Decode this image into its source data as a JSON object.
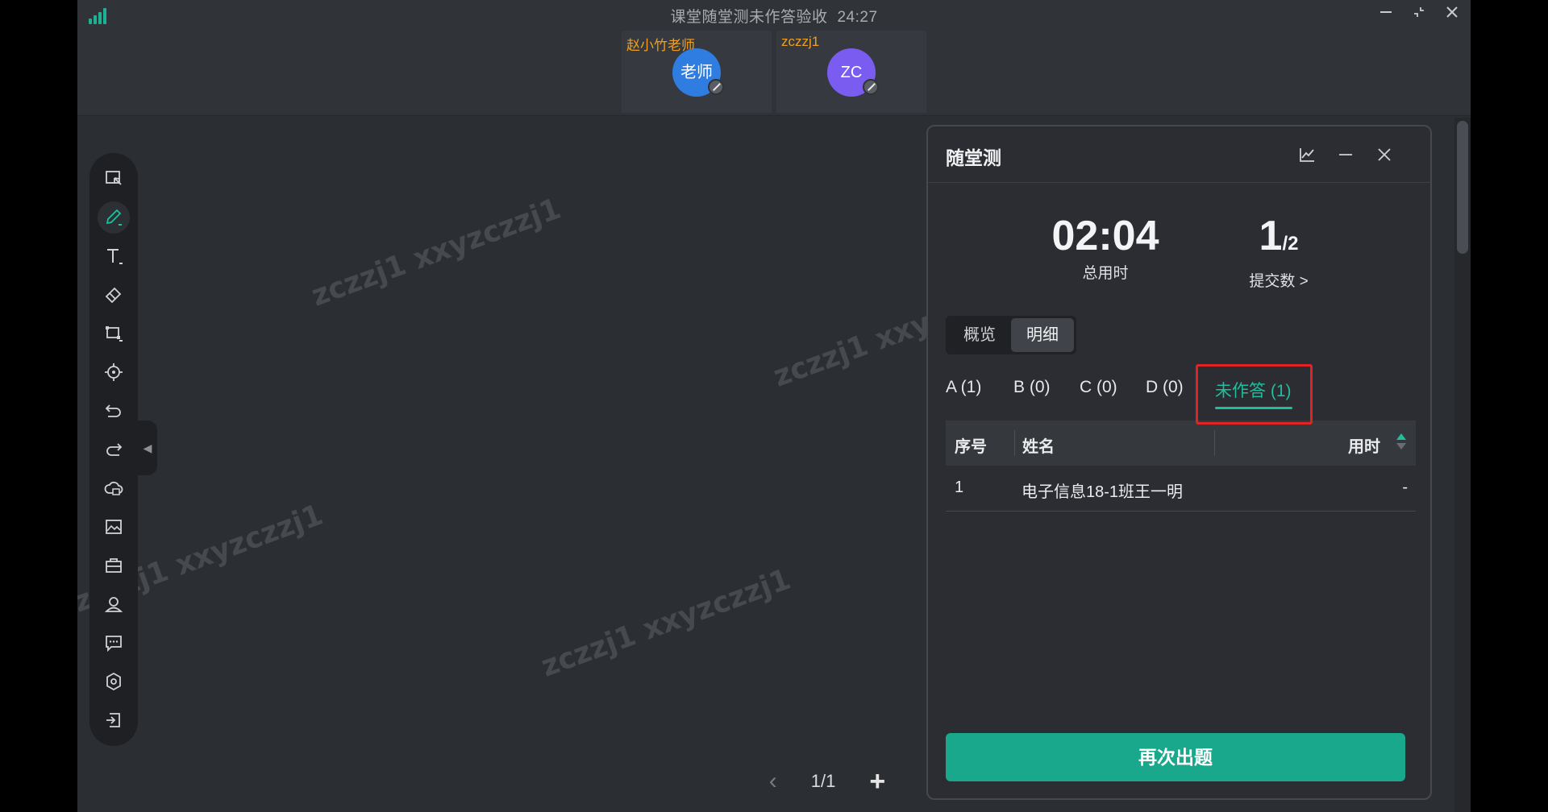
{
  "window": {
    "title": "课堂随堂测未作答验收",
    "elapsed": "24:27",
    "icons": [
      "signal-icon",
      "minimize-icon",
      "restore-icon",
      "close-icon"
    ]
  },
  "participants": [
    {
      "name": "赵小竹老师",
      "avatar_text": "老师",
      "name_color": "#f0a020",
      "avatar_color": "#2f7de1"
    },
    {
      "name": "zczzj1",
      "avatar_text": "ZC",
      "name_color": "#f0a020",
      "avatar_color": "#7b5cf0"
    }
  ],
  "toolbar": {
    "tools": [
      "select-icon",
      "pen-icon",
      "text-icon",
      "eraser-icon",
      "shape-icon",
      "laser-pointer-icon",
      "undo-icon",
      "redo-icon",
      "cloud-file-icon",
      "image-icon",
      "toolbox-icon",
      "user-icon",
      "chat-icon",
      "settings-icon",
      "exit-icon"
    ],
    "active_tool": "pen-icon"
  },
  "watermark": "zczzj1 xxyzczzj1",
  "pager": {
    "current": "1/1"
  },
  "quiz": {
    "title": "随堂测",
    "total_time": "02:04",
    "total_time_label": "总用时",
    "submitted": "1",
    "submitted_total": "/2",
    "submitted_label": "提交数 >",
    "view_tabs": [
      "概览",
      "明细"
    ],
    "active_view": "明细",
    "filter_tabs": [
      "A (1)",
      "B (0)",
      "C (0)",
      "D (0)",
      "未作答 (1)"
    ],
    "active_filter": "未作答 (1)",
    "columns": {
      "index": "序号",
      "name": "姓名",
      "time": "用时"
    },
    "rows": [
      {
        "index": "1",
        "name": "电子信息18-1班王一明",
        "time": "-"
      }
    ],
    "action_button": "再次出题"
  },
  "colors": {
    "accent": "#19a88c",
    "highlight": "#e02424",
    "background": "#2b2e33"
  }
}
